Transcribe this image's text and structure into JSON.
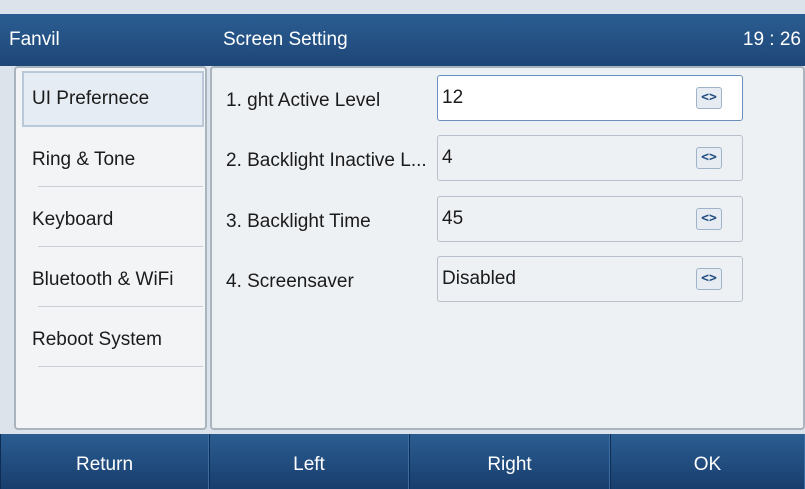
{
  "status_bar": {
    "brand": "Fanvil",
    "title": "Screen Setting",
    "time": "19 : 26"
  },
  "sidebar": {
    "items": [
      {
        "label": "UI Prefernece",
        "selected": true
      },
      {
        "label": "Ring & Tone",
        "selected": false
      },
      {
        "label": "Keyboard",
        "selected": false
      },
      {
        "label": "Bluetooth & WiFi",
        "selected": false
      },
      {
        "label": "Reboot System",
        "selected": false
      }
    ]
  },
  "settings": [
    {
      "label": "1. ght Active Level",
      "value": "12",
      "active": true
    },
    {
      "label": "2. Backlight Inactive L...",
      "value": "4",
      "active": false
    },
    {
      "label": "3. Backlight Time",
      "value": "45",
      "active": false
    },
    {
      "label": "4. Screensaver",
      "value": "Disabled",
      "active": false
    }
  ],
  "arrows_glyph": "<>",
  "softkeys": [
    "Return",
    "Left",
    "Right",
    "OK"
  ],
  "colors": {
    "bar_blue": "#1e4677",
    "panel_bg": "#eef1f4",
    "active_field_border": "#6b8fbf"
  }
}
